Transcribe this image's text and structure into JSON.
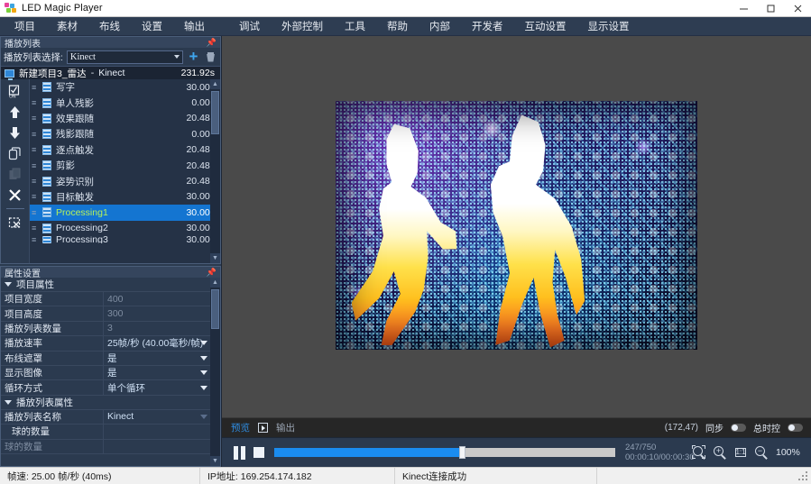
{
  "window": {
    "title": "LED Magic Player",
    "minimize": "─",
    "maximize": "☐",
    "close": "✕"
  },
  "menubar": {
    "items": [
      {
        "label": "项目"
      },
      {
        "label": "素材"
      },
      {
        "label": "布线"
      },
      {
        "label": "设置"
      },
      {
        "label": "输出"
      },
      {
        "label": "调试"
      },
      {
        "label": "外部控制"
      },
      {
        "label": "工具"
      },
      {
        "label": "帮助"
      },
      {
        "label": "内部"
      },
      {
        "label": "开发者"
      },
      {
        "label": "互动设置"
      },
      {
        "label": "显示设置"
      }
    ]
  },
  "playlist_panel": {
    "title": "播放列表",
    "pin_icon": "pin-icon",
    "selector_label": "播放列表选择:",
    "selector_value": "Kinect",
    "add_button": "+",
    "delete_button": "trash-icon",
    "project": {
      "name": "新建项目3_雷达",
      "separator": "-",
      "source": "Kinect",
      "duration": "231.92s"
    },
    "tools": [
      {
        "name": "toggle-on-icon",
        "glyph": "on"
      },
      {
        "name": "move-up-icon",
        "glyph": "↑"
      },
      {
        "name": "move-down-icon",
        "glyph": "↓"
      },
      {
        "name": "copy-icon",
        "glyph": "copy"
      },
      {
        "name": "paste-icon",
        "glyph": "paste"
      },
      {
        "name": "delete-icon",
        "glyph": "✕"
      },
      {
        "name": "clear-list-icon",
        "glyph": "clear"
      }
    ],
    "items": [
      {
        "name": "写字",
        "duration": "30.00s",
        "selected": false
      },
      {
        "name": "单人残影",
        "duration": "0.00s",
        "selected": false
      },
      {
        "name": "效果跟随",
        "duration": "20.48s",
        "selected": false
      },
      {
        "name": "残影跟随",
        "duration": "0.00s",
        "selected": false
      },
      {
        "name": "逐点触发",
        "duration": "20.48s",
        "selected": false
      },
      {
        "name": "剪影",
        "duration": "20.48s",
        "selected": false
      },
      {
        "name": "姿势识别",
        "duration": "20.48s",
        "selected": false
      },
      {
        "name": "目标触发",
        "duration": "30.00s",
        "selected": false
      },
      {
        "name": "Processing1",
        "duration": "30.00s",
        "selected": true
      },
      {
        "name": "Processing2",
        "duration": "30.00s",
        "selected": false
      },
      {
        "name": "Processing3",
        "duration": "30.00s",
        "selected": false
      }
    ]
  },
  "properties_panel": {
    "title": "属性设置",
    "pin_icon": "pin-icon",
    "sections": [
      {
        "heading": "项目属性",
        "rows": [
          {
            "key": "项目宽度",
            "value": "400",
            "style": "dim",
            "control": "text"
          },
          {
            "key": "项目高度",
            "value": "300",
            "style": "dim",
            "control": "text"
          },
          {
            "key": "播放列表数量",
            "value": "3",
            "style": "dim",
            "control": "text"
          },
          {
            "key": "播放速率",
            "value": "25帧/秒 (40.00毫秒/帧)",
            "style": "norm",
            "control": "dropdown"
          },
          {
            "key": "布线遮罩",
            "value": "是",
            "style": "norm",
            "control": "dropdown"
          },
          {
            "key": "显示图像",
            "value": "是",
            "style": "norm",
            "control": "dropdown"
          },
          {
            "key": "循环方式",
            "value": "单个循环",
            "style": "norm",
            "control": "dropdown"
          }
        ]
      },
      {
        "heading": "播放列表属性",
        "rows": [
          {
            "key": "播放列表名称",
            "value": "Kinect",
            "style": "norm",
            "control": "dropdown-soft"
          },
          {
            "key": "球的数量",
            "value": "",
            "style": "norm",
            "control": "header"
          },
          {
            "key": "球的数量",
            "value": "",
            "style": "dim",
            "control": "text"
          }
        ]
      }
    ]
  },
  "preview": {
    "tabs": [
      {
        "label": "预览",
        "active": true
      },
      {
        "label": "输出",
        "active": false
      }
    ],
    "tab_icon": "output-window-icon",
    "coordinates": "(172,47)",
    "toggles": [
      {
        "label": "同步",
        "name": "sync-toggle",
        "on": false
      },
      {
        "label": "总时控",
        "name": "master-time-toggle",
        "on": false
      }
    ]
  },
  "transport": {
    "pause_button": "pause-icon",
    "stop_button": "stop-icon",
    "progress_percent": 55,
    "frame_counter": "247/750",
    "time_counter": "00:00:10/00:00:30",
    "zoom_buttons": [
      {
        "name": "zoom-select-icon",
        "glyph": "select"
      },
      {
        "name": "zoom-in-icon",
        "glyph": "+"
      },
      {
        "name": "zoom-actual-size-icon",
        "glyph": "1:1"
      },
      {
        "name": "zoom-out-icon",
        "glyph": "−"
      }
    ],
    "zoom_level": "100%"
  },
  "statusbar": {
    "framerate": "帧速: 25.00 帧/秒 (40ms)",
    "ip_address": "IP地址: 169.254.174.182",
    "kinect_status": "Kinect连接成功",
    "empty": ""
  },
  "colors": {
    "accent_blue": "#1475d1",
    "panel_bg": "#2b3a4f",
    "list_bg": "#253246",
    "selected_text": "#b6f05a",
    "stage_bg": "#4a4a4a"
  }
}
